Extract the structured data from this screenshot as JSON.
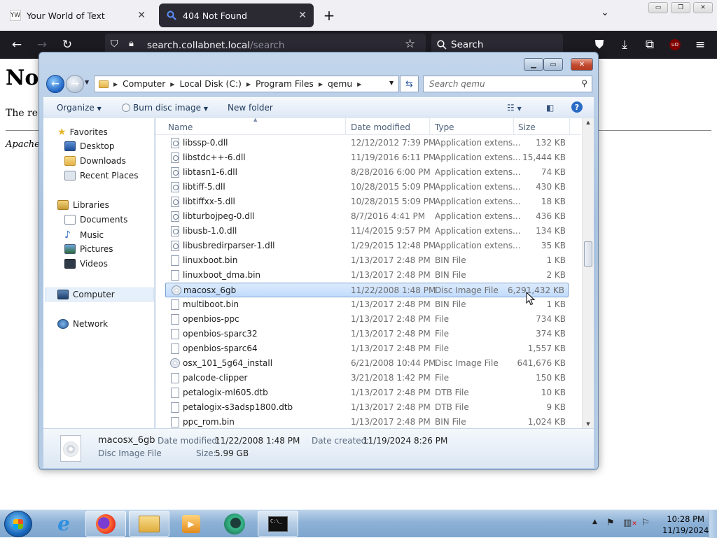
{
  "browser": {
    "tabs": [
      {
        "title": "Your World of Text",
        "favicon": "YW"
      },
      {
        "title": "404 Not Found"
      }
    ],
    "url_host": "search.collabnet.local",
    "url_path": "/search",
    "search_placeholder": "Search",
    "window_controls": {
      "minimize": "▭",
      "restore": "❐",
      "close": "✕"
    }
  },
  "page": {
    "heading": "Not",
    "paragraph": "The req",
    "address": "Apache"
  },
  "explorer": {
    "breadcrumb": [
      "Computer",
      "Local Disk (C:)",
      "Program Files",
      "qemu"
    ],
    "search_placeholder": "Search qemu",
    "toolbar": {
      "organize": "Organize",
      "burn": "Burn disc image",
      "new_folder": "New folder"
    },
    "nav": {
      "favorites": "Favorites",
      "desktop": "Desktop",
      "downloads": "Downloads",
      "recent": "Recent Places",
      "libraries": "Libraries",
      "documents": "Documents",
      "music": "Music",
      "pictures": "Pictures",
      "videos": "Videos",
      "computer": "Computer",
      "network": "Network"
    },
    "columns": {
      "name": "Name",
      "date": "Date modified",
      "type": "Type",
      "size": "Size"
    },
    "files": [
      {
        "name": "libssp-0.dll",
        "date": "12/12/2012 7:39 PM",
        "type": "Application extens...",
        "size": "132 KB",
        "icon": "dll"
      },
      {
        "name": "libstdc++-6.dll",
        "date": "11/19/2016 6:11 PM",
        "type": "Application extens...",
        "size": "15,444 KB",
        "icon": "dll"
      },
      {
        "name": "libtasn1-6.dll",
        "date": "8/28/2016 6:00 PM",
        "type": "Application extens...",
        "size": "74 KB",
        "icon": "dll"
      },
      {
        "name": "libtiff-5.dll",
        "date": "10/28/2015 5:09 PM",
        "type": "Application extens...",
        "size": "430 KB",
        "icon": "dll"
      },
      {
        "name": "libtiffxx-5.dll",
        "date": "10/28/2015 5:09 PM",
        "type": "Application extens...",
        "size": "18 KB",
        "icon": "dll"
      },
      {
        "name": "libturbojpeg-0.dll",
        "date": "8/7/2016 4:41 PM",
        "type": "Application extens...",
        "size": "436 KB",
        "icon": "dll"
      },
      {
        "name": "libusb-1.0.dll",
        "date": "11/4/2015 9:57 PM",
        "type": "Application extens...",
        "size": "134 KB",
        "icon": "dll"
      },
      {
        "name": "libusbredirparser-1.dll",
        "date": "1/29/2015 12:48 PM",
        "type": "Application extens...",
        "size": "35 KB",
        "icon": "dll"
      },
      {
        "name": "linuxboot.bin",
        "date": "1/13/2017 2:48 PM",
        "type": "BIN File",
        "size": "1 KB",
        "icon": "file"
      },
      {
        "name": "linuxboot_dma.bin",
        "date": "1/13/2017 2:48 PM",
        "type": "BIN File",
        "size": "2 KB",
        "icon": "file"
      },
      {
        "name": "macosx_6gb",
        "date": "11/22/2008 1:48 PM",
        "type": "Disc Image File",
        "size": "6,291,432 KB",
        "icon": "disc",
        "selected": true
      },
      {
        "name": "multiboot.bin",
        "date": "1/13/2017 2:48 PM",
        "type": "BIN File",
        "size": "1 KB",
        "icon": "file"
      },
      {
        "name": "openbios-ppc",
        "date": "1/13/2017 2:48 PM",
        "type": "File",
        "size": "734 KB",
        "icon": "file"
      },
      {
        "name": "openbios-sparc32",
        "date": "1/13/2017 2:48 PM",
        "type": "File",
        "size": "374 KB",
        "icon": "file"
      },
      {
        "name": "openbios-sparc64",
        "date": "1/13/2017 2:48 PM",
        "type": "File",
        "size": "1,557 KB",
        "icon": "file"
      },
      {
        "name": "osx_101_5g64_install",
        "date": "6/21/2008 10:44 PM",
        "type": "Disc Image File",
        "size": "641,676 KB",
        "icon": "disc"
      },
      {
        "name": "palcode-clipper",
        "date": "3/21/2018 1:42 PM",
        "type": "File",
        "size": "150 KB",
        "icon": "file"
      },
      {
        "name": "petalogix-ml605.dtb",
        "date": "1/13/2017 2:48 PM",
        "type": "DTB File",
        "size": "10 KB",
        "icon": "file"
      },
      {
        "name": "petalogix-s3adsp1800.dtb",
        "date": "1/13/2017 2:48 PM",
        "type": "DTB File",
        "size": "9 KB",
        "icon": "file"
      },
      {
        "name": "ppc_rom.bin",
        "date": "1/13/2017 2:48 PM",
        "type": "BIN File",
        "size": "1,024 KB",
        "icon": "file"
      }
    ],
    "details": {
      "name": "macosx_6gb",
      "type": "Disc Image File",
      "modified_label": "Date modified:",
      "modified": "11/22/2008 1:48 PM",
      "created_label": "Date created:",
      "created": "11/19/2024 8:26 PM",
      "size_label": "Size:",
      "size": "5.99 GB"
    }
  },
  "taskbar": {
    "time": "10:28 PM",
    "date": "11/19/2024",
    "apps": [
      "internet-explorer",
      "firefox",
      "file-explorer",
      "media-player",
      "app-globe",
      "command-prompt"
    ]
  }
}
